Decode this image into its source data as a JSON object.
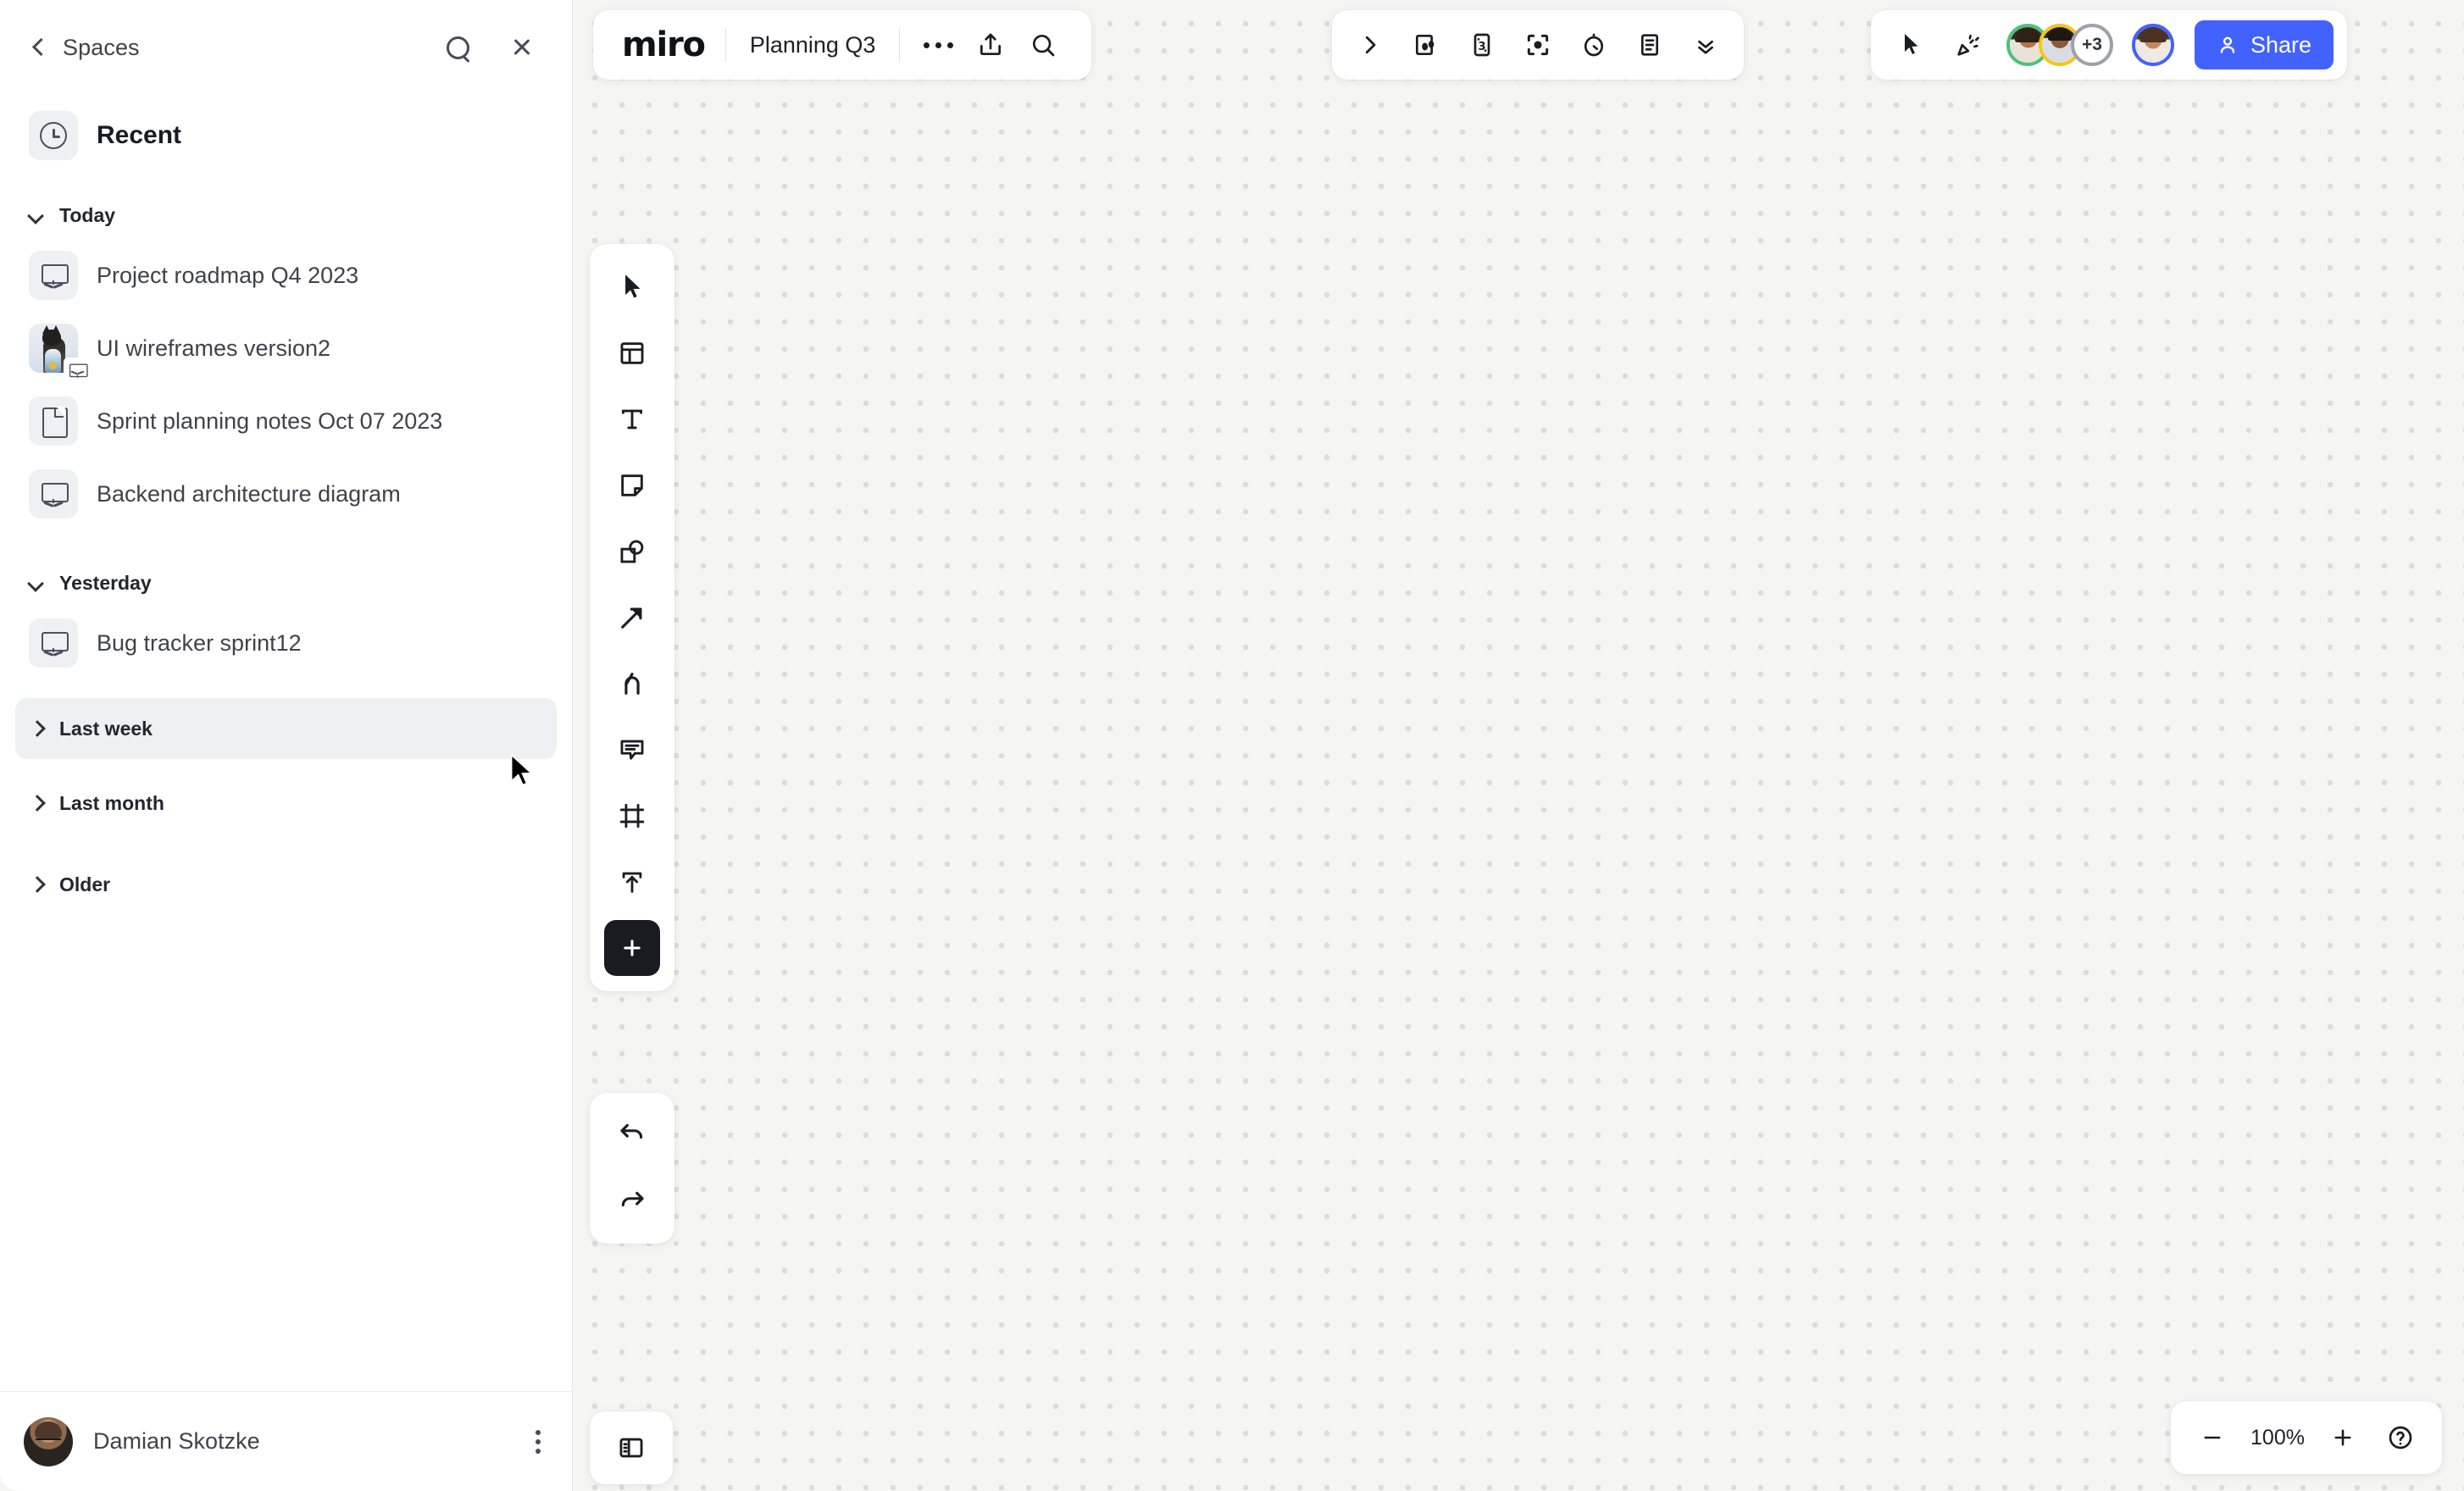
{
  "sidebar": {
    "back_label": "Spaces",
    "search_icon": "search-icon",
    "close_icon": "close-icon",
    "section_title": "Recent",
    "section_icon": "clock-icon",
    "groups": [
      {
        "label": "Today",
        "expanded": true,
        "highlighted": false,
        "items": [
          {
            "label": "Project roadmap Q4 2023",
            "icon": "board-icon"
          },
          {
            "label": "UI wireframes version2",
            "icon": "board-thumbnail"
          },
          {
            "label": "Sprint planning notes Oct 07 2023",
            "icon": "document-icon"
          },
          {
            "label": "Backend architecture diagram",
            "icon": "board-icon"
          }
        ]
      },
      {
        "label": "Yesterday",
        "expanded": true,
        "highlighted": false,
        "items": [
          {
            "label": "Bug tracker sprint12",
            "icon": "board-icon"
          }
        ]
      },
      {
        "label": "Last week",
        "expanded": false,
        "highlighted": true,
        "items": []
      },
      {
        "label": "Last month",
        "expanded": false,
        "highlighted": false,
        "items": []
      },
      {
        "label": "Older",
        "expanded": false,
        "highlighted": false,
        "items": []
      }
    ],
    "user": {
      "name": "Damian Skotzke",
      "menu_icon": "kebab-menu-icon"
    }
  },
  "header": {
    "logo_text": "miro",
    "board_title": "Planning Q3",
    "more_icon": "more-options-icon",
    "share_icon": "upload-share-icon",
    "search_icon": "search-icon",
    "tools": [
      {
        "name": "expand-panel-icon",
        "label": "Expand"
      },
      {
        "name": "present-icon",
        "label": "Presentation"
      },
      {
        "name": "voting-icon",
        "label": "Voting"
      },
      {
        "name": "focus-mode-icon",
        "label": "Focus mode"
      },
      {
        "name": "timer-icon",
        "label": "Timer"
      },
      {
        "name": "notes-icon",
        "label": "Notes"
      },
      {
        "name": "chevrons-down-icon",
        "label": "More apps"
      }
    ],
    "right": {
      "cursor_icon": "pointer-cursor-icon",
      "reactions_icon": "party-popper-icon",
      "collaborators": [
        {
          "ring_color": "#4bc27d"
        },
        {
          "ring_color": "#f5c518"
        }
      ],
      "overflow_count": "+3",
      "me_ring_color": "#4262ff",
      "share_label": "Share",
      "share_icon": "person-icon",
      "share_color": "#4262ff"
    }
  },
  "toolbar": {
    "items": [
      {
        "name": "select-tool",
        "label": "Select"
      },
      {
        "name": "templates-tool",
        "label": "Templates"
      },
      {
        "name": "text-tool",
        "label": "Text"
      },
      {
        "name": "sticky-note-tool",
        "label": "Sticky note"
      },
      {
        "name": "shapes-tool",
        "label": "Shapes"
      },
      {
        "name": "arrow-tool",
        "label": "Connection line"
      },
      {
        "name": "pen-tool",
        "label": "Pen"
      },
      {
        "name": "comment-tool",
        "label": "Comment"
      },
      {
        "name": "frame-tool",
        "label": "Frame"
      },
      {
        "name": "upload-tool",
        "label": "Upload"
      },
      {
        "name": "more-tools",
        "label": "More tools"
      }
    ],
    "history": [
      {
        "name": "undo-button",
        "label": "Undo"
      },
      {
        "name": "redo-button",
        "label": "Redo"
      }
    ]
  },
  "footer": {
    "panel_toggle_icon": "toggle-side-panel-icon",
    "zoom_out_icon": "minus-icon",
    "zoom_level": "100%",
    "zoom_in_icon": "plus-icon",
    "help_icon": "help-circle-icon"
  }
}
